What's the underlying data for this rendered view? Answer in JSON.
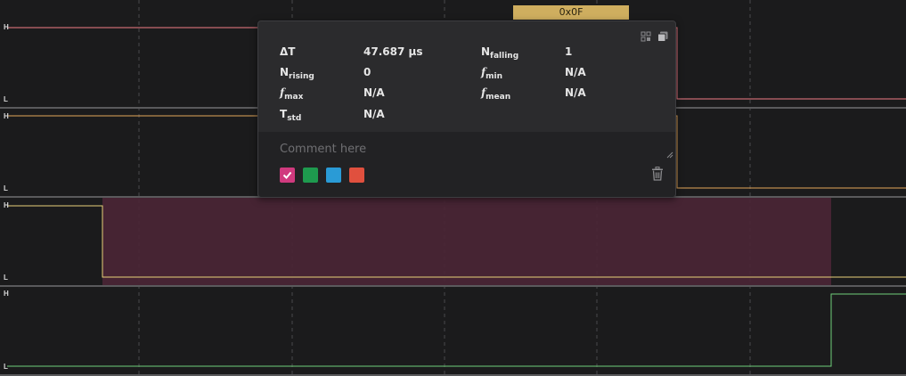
{
  "channels": [
    {
      "high_label": "H",
      "low_label": "L",
      "color": "#f07c86"
    },
    {
      "high_label": "H",
      "low_label": "L",
      "color": "#e3a75a"
    },
    {
      "high_label": "H",
      "low_label": "L",
      "color": "#e8d27a"
    },
    {
      "high_label": "H",
      "low_label": "L",
      "color": "#6fcf7a"
    }
  ],
  "protocol_badge": {
    "text": "0x0F",
    "color": "#cfae5f"
  },
  "selection_highlight_color": "#4a2535",
  "measurement": {
    "delta_t": {
      "label": "ΔT",
      "value": "47.687 μs"
    },
    "n_falling": {
      "label": "N",
      "sub": "falling",
      "value": "1"
    },
    "n_rising": {
      "label": "N",
      "sub": "rising",
      "value": "0"
    },
    "f_min": {
      "label": "f",
      "sub": "min",
      "value": "N/A"
    },
    "f_max": {
      "label": "f",
      "sub": "max",
      "value": "N/A"
    },
    "f_mean": {
      "label": "f",
      "sub": "mean",
      "value": "N/A"
    },
    "t_std": {
      "label": "T",
      "sub": "std",
      "value": "N/A"
    }
  },
  "comment": {
    "placeholder": "Comment here",
    "value": ""
  },
  "color_swatches": [
    {
      "name": "pink",
      "color": "#d03a7e",
      "selected": true
    },
    {
      "name": "green",
      "color": "#1e9a4e",
      "selected": false
    },
    {
      "name": "blue",
      "color": "#2a9bd6",
      "selected": false
    },
    {
      "name": "red",
      "color": "#e0503e",
      "selected": false
    }
  ],
  "icons": {
    "expand": "expand-icon",
    "copy": "copy-icon",
    "delete": "trash-icon",
    "resize": "resize-grip-icon",
    "check": "check-icon"
  }
}
